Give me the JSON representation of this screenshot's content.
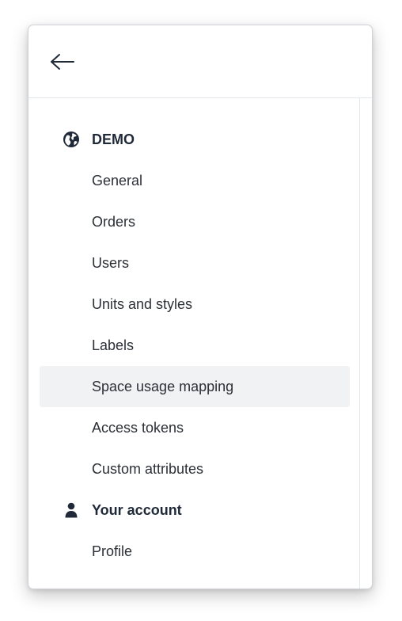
{
  "header": {
    "back_icon": "arrow-left-icon"
  },
  "nav": {
    "sections": [
      {
        "label": "DEMO",
        "icon": "globe-icon",
        "items": [
          {
            "label": "General"
          },
          {
            "label": "Orders"
          },
          {
            "label": "Users"
          },
          {
            "label": "Units and styles"
          },
          {
            "label": "Labels"
          },
          {
            "label": "Space usage mapping",
            "active": true
          },
          {
            "label": "Access tokens"
          },
          {
            "label": "Custom attributes"
          }
        ]
      },
      {
        "label": "Your account",
        "icon": "user-icon",
        "items": [
          {
            "label": "Profile"
          }
        ]
      }
    ]
  },
  "colors": {
    "text": "#2b2f36",
    "heading": "#1f2937",
    "active_bg": "#f1f2f4",
    "border": "#cfd3d8"
  }
}
